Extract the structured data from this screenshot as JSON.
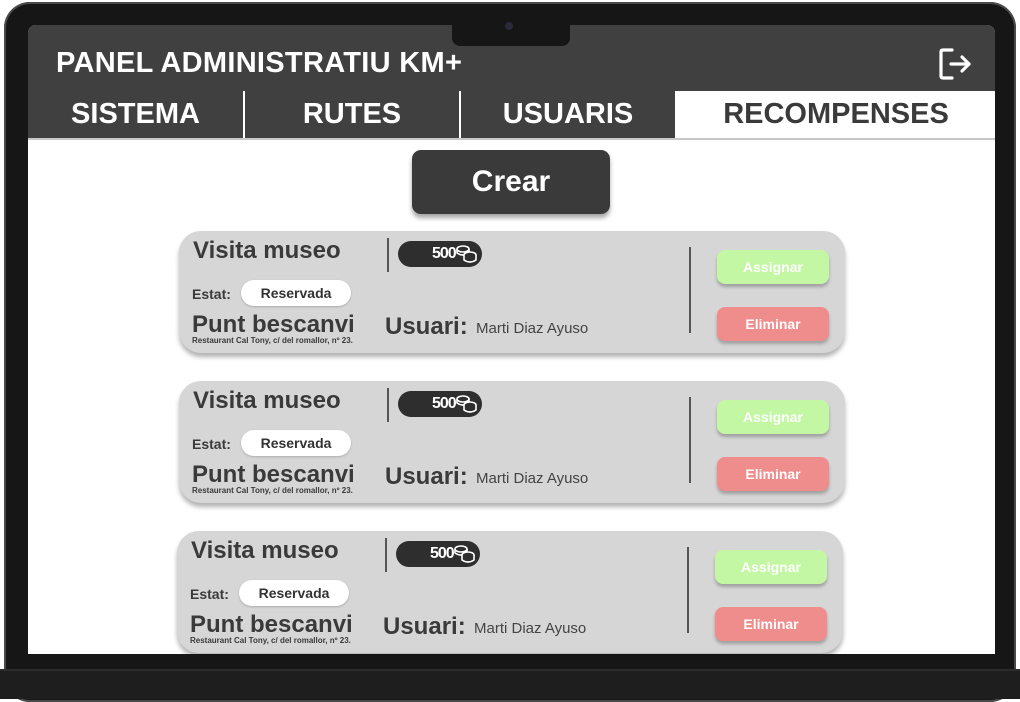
{
  "app": {
    "title": "PANEL ADMINISTRATIU KM+"
  },
  "header": {
    "logout_icon": "logout-icon"
  },
  "tabs": [
    {
      "label": "SISTEMA",
      "active": false
    },
    {
      "label": "RUTES",
      "active": false
    },
    {
      "label": "USUARIS",
      "active": false
    },
    {
      "label": "RECOMPENSES",
      "active": true
    }
  ],
  "actions": {
    "crear_label": "Crear"
  },
  "colors": {
    "header": "#404040",
    "assign": "#c4f7a4",
    "delete": "#ef8c8c",
    "card": "#d6d6d6"
  },
  "rewards": [
    {
      "title": "Visita museo",
      "coins": "500",
      "coin_icon": "coins-icon",
      "estat_label": "Estat:",
      "estat_value": "Reservada",
      "punt_label": "Punt bescanvi",
      "punt_address": "Restaurant Cal Tony,  c/ del romallor,  nº 23.",
      "usuari_label": "Usuari:",
      "usuari_value": "Marti Diaz Ayuso",
      "assign_label": "Assignar",
      "delete_label": "Eliminar"
    },
    {
      "title": "Visita museo",
      "coins": "500",
      "coin_icon": "coins-icon",
      "estat_label": "Estat:",
      "estat_value": "Reservada",
      "punt_label": "Punt bescanvi",
      "punt_address": "Restaurant Cal Tony,  c/ del romallor,  nº 23.",
      "usuari_label": "Usuari:",
      "usuari_value": "Marti Diaz Ayuso",
      "assign_label": "Assignar",
      "delete_label": "Eliminar"
    },
    {
      "title": "Visita museo",
      "coins": "500",
      "coin_icon": "coins-icon",
      "estat_label": "Estat:",
      "estat_value": "Reservada",
      "punt_label": "Punt bescanvi",
      "punt_address": "Restaurant Cal Tony,  c/ del romallor,  nº 23.",
      "usuari_label": "Usuari:",
      "usuari_value": "Marti Diaz Ayuso",
      "assign_label": "Assignar",
      "delete_label": "Eliminar"
    }
  ]
}
